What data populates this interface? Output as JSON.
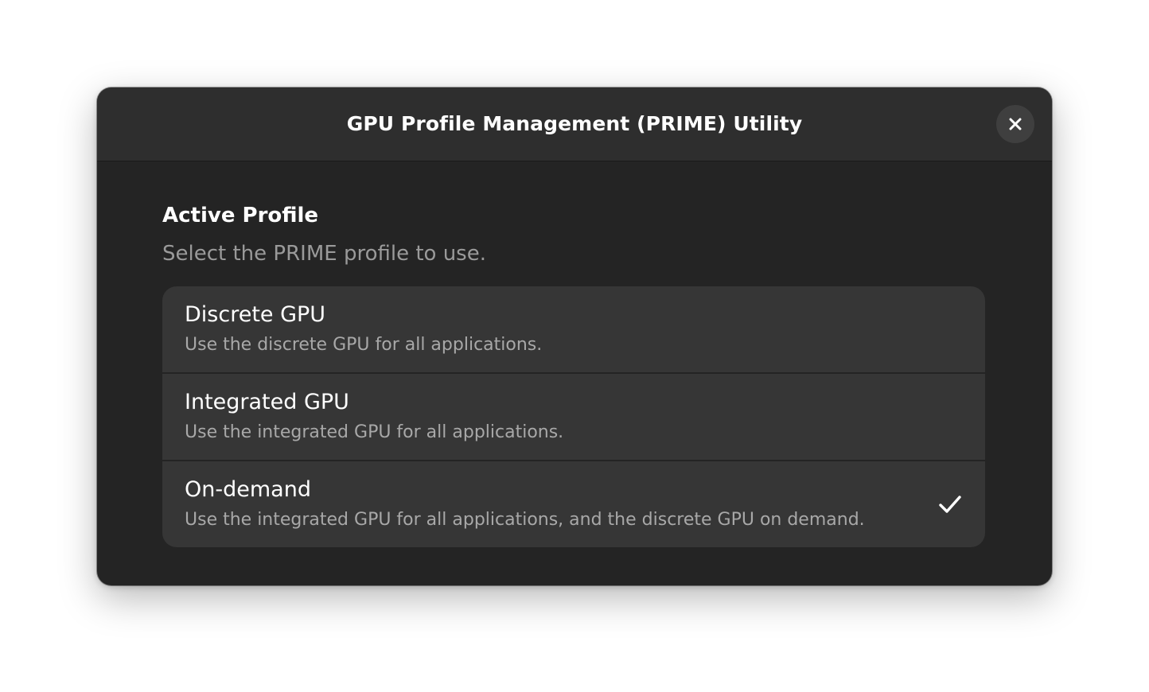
{
  "window": {
    "title": "GPU Profile Management (PRIME) Utility",
    "close_icon": "close-icon"
  },
  "profile_group": {
    "title": "Active Profile",
    "description": "Select the PRIME profile to use."
  },
  "profiles": [
    {
      "title": "Discrete GPU",
      "subtitle": "Use the discrete GPU for all applications.",
      "selected": false
    },
    {
      "title": "Integrated GPU",
      "subtitle": "Use the integrated GPU for all applications.",
      "selected": false
    },
    {
      "title": "On-demand",
      "subtitle": "Use the integrated GPU for all applications, and the discrete GPU on demand.",
      "selected": true,
      "indicator_icon": "checkmark-icon"
    }
  ],
  "colors": {
    "window_bg": "#242424",
    "headerbar_bg": "#2e2e2e",
    "list_bg": "#363636",
    "text_primary": "#ffffff",
    "text_secondary": "#a8a8a8"
  }
}
